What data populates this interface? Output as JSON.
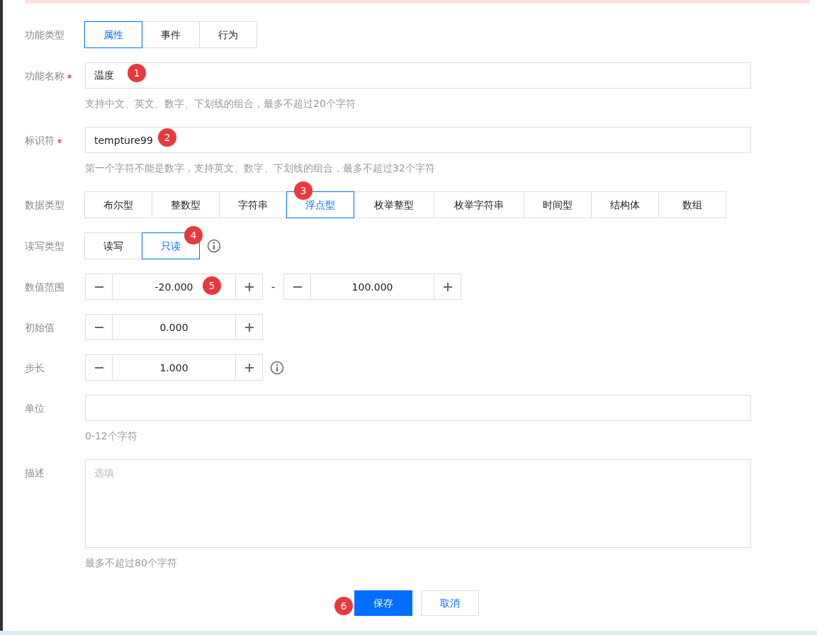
{
  "form": {
    "rows": [
      {
        "kind": "segmented",
        "label": "功能类型",
        "options": [
          {
            "label": "属性",
            "selected": true
          },
          {
            "label": "事件",
            "selected": false
          },
          {
            "label": "行为",
            "selected": false
          }
        ]
      },
      {
        "kind": "text",
        "label": "功能名称",
        "required": true,
        "value": "温度",
        "annotation": "1",
        "hint": "支持中文、英文、数字、下划线的组合，最多不超过20个字符"
      },
      {
        "kind": "text",
        "label": "标识符",
        "required": true,
        "value": "tempture99",
        "annotation": "2",
        "hint": "第一个字符不能是数字，支持英文、数字、下划线的组合，最多不超过32个字符"
      },
      {
        "kind": "segmented",
        "label": "数据类型",
        "options": [
          {
            "label": "布尔型",
            "selected": false
          },
          {
            "label": "整数型",
            "selected": false
          },
          {
            "label": "字符串",
            "selected": false
          },
          {
            "label": "浮点型",
            "selected": true,
            "annotation": "3"
          },
          {
            "label": "枚举整型",
            "selected": false
          },
          {
            "label": "枚举字符串",
            "selected": false
          },
          {
            "label": "时间型",
            "selected": false
          },
          {
            "label": "结构体",
            "selected": false
          },
          {
            "label": "数组",
            "selected": false
          }
        ]
      },
      {
        "kind": "segmented",
        "label": "读写类型",
        "info": true,
        "options": [
          {
            "label": "读写",
            "selected": false
          },
          {
            "label": "只读",
            "selected": true,
            "annotation": "4"
          }
        ]
      },
      {
        "kind": "range",
        "label": "数值范围",
        "min": {
          "value": "-20.000",
          "annotation": "5"
        },
        "separator": "-",
        "max": {
          "value": "100.000"
        }
      },
      {
        "kind": "stepper",
        "label": "初始值",
        "value": "0.000"
      },
      {
        "kind": "stepper",
        "label": "步长",
        "value": "1.000",
        "info": true
      },
      {
        "kind": "text",
        "label": "单位",
        "hint": "0-12个字符"
      },
      {
        "kind": "textarea",
        "label": "描述",
        "placeholder": "选填",
        "hint": "最多不超过80个字符"
      }
    ],
    "buttons": [
      {
        "label": "保存",
        "kind": "primary",
        "annotation": "6"
      },
      {
        "label": "取消",
        "kind": "secondary"
      }
    ]
  }
}
